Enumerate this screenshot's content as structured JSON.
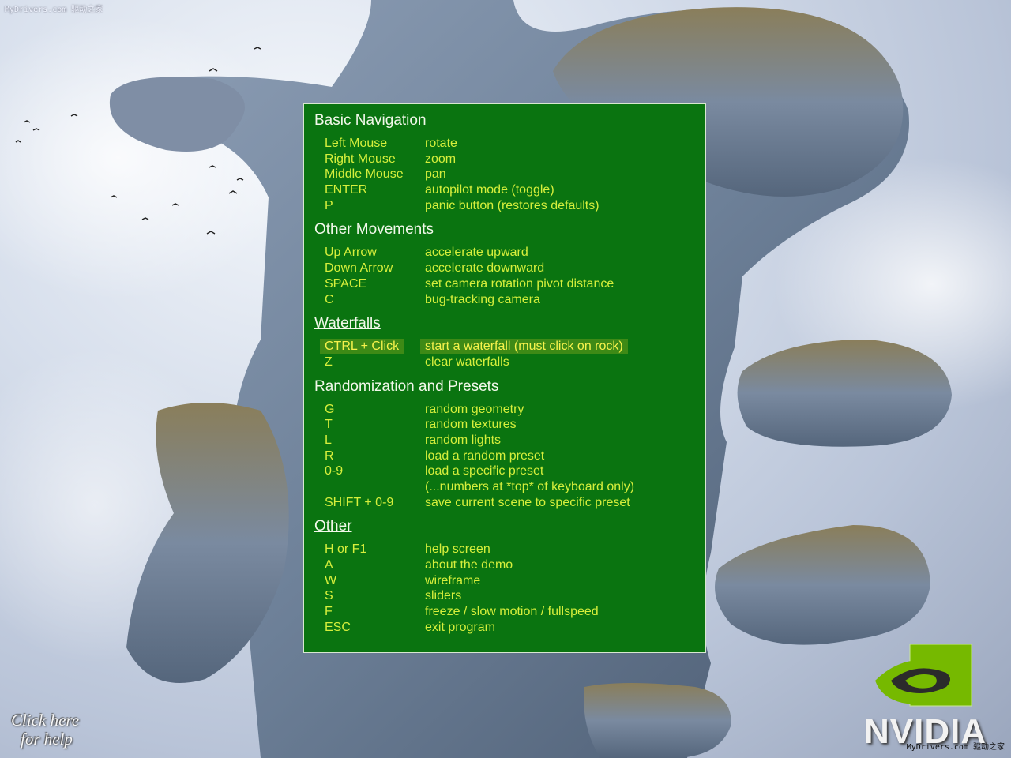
{
  "watermark_top": "MyDrivers.com 驱动之家",
  "watermark_bottom": "MyDrivers.com 驱动之家",
  "help": {
    "sections": [
      {
        "title": "Basic Navigation",
        "rows": [
          {
            "key": "Left Mouse",
            "action": "rotate"
          },
          {
            "key": "Right Mouse",
            "action": "zoom"
          },
          {
            "key": "Middle Mouse",
            "action": "pan"
          },
          {
            "key": "ENTER",
            "action": "autopilot mode (toggle)"
          },
          {
            "key": "P",
            "action": "panic button (restores defaults)"
          }
        ]
      },
      {
        "title": "Other Movements",
        "rows": [
          {
            "key": "Up Arrow",
            "action": "accelerate upward"
          },
          {
            "key": "Down Arrow",
            "action": "accelerate downward"
          },
          {
            "key": "SPACE",
            "action": "set camera rotation pivot distance"
          },
          {
            "key": "C",
            "action": "bug-tracking camera"
          }
        ]
      },
      {
        "title": "Waterfalls",
        "rows": [
          {
            "key": "CTRL + Click",
            "action": "start a waterfall (must click on rock)"
          },
          {
            "key": "Z",
            "action": "clear waterfalls"
          }
        ]
      },
      {
        "title": "Randomization and Presets",
        "rows": [
          {
            "key": "G",
            "action": "random geometry"
          },
          {
            "key": "T",
            "action": "random textures"
          },
          {
            "key": "L",
            "action": "random lights"
          },
          {
            "key": "R",
            "action": "load a random preset"
          },
          {
            "key": "0-9",
            "action": "load a specific preset"
          },
          {
            "key": "",
            "action": "(...numbers at *top* of keyboard only)"
          },
          {
            "key": "SHIFT + 0-9",
            "action": "save current scene to specific preset"
          }
        ]
      },
      {
        "title": "Other",
        "rows": [
          {
            "key": "H or F1",
            "action": "help screen"
          },
          {
            "key": "A",
            "action": "about the demo"
          },
          {
            "key": "W",
            "action": "wireframe"
          },
          {
            "key": "S",
            "action": "sliders"
          },
          {
            "key": "F",
            "action": "freeze / slow motion / fullspeed"
          },
          {
            "key": "ESC",
            "action": "exit program"
          }
        ]
      }
    ]
  },
  "click_help": {
    "line1": "Click here",
    "line2": "for help"
  },
  "logo_text": "NVIDIA",
  "colors": {
    "panel_bg": "#0a7410",
    "key_text": "#d6ef3c",
    "title_text": "#f2f8ea",
    "highlight_bg": "#3e8a16",
    "logo_green": "#76b900"
  }
}
